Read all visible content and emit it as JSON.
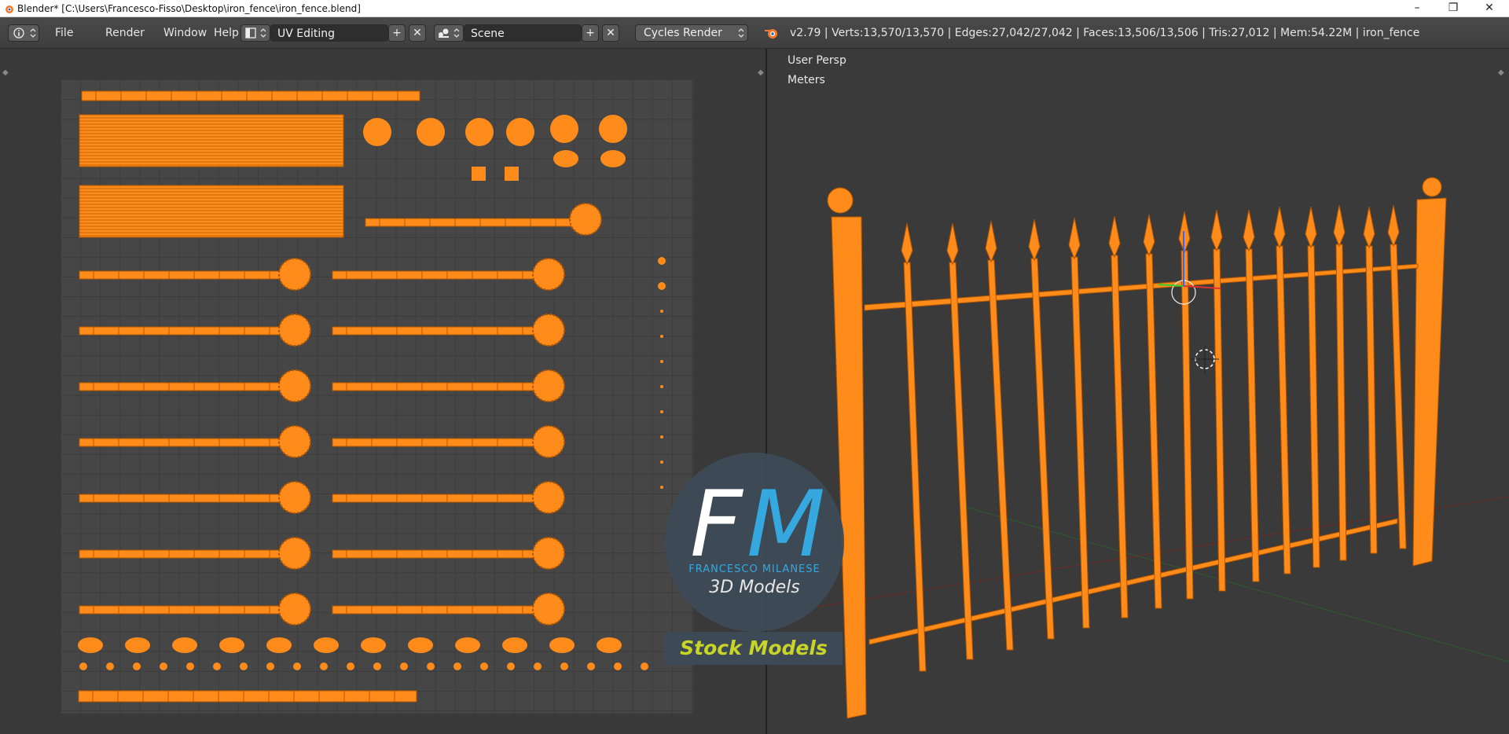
{
  "window": {
    "title": "Blender* [C:\\Users\\Francesco-Fisso\\Desktop\\iron_fence\\iron_fence.blend]",
    "controls": [
      "–",
      "❐",
      "✕"
    ]
  },
  "header": {
    "menus": [
      "File",
      "Render",
      "Window",
      "Help"
    ],
    "screen_layout": "UV Editing",
    "scene": "Scene",
    "render_engine": "Cycles Render",
    "stats": "v2.79 | Verts:13,570/13,570 | Edges:27,042/27,042 | Faces:13,506/13,506 | Tris:27,012 | Mem:54.22M | iron_fence",
    "add_glyph": "+",
    "remove_glyph": "✕"
  },
  "viewport": {
    "view_name": "User Persp",
    "units": "Meters"
  },
  "watermark": {
    "brand": "FRANCESCO MILANESE",
    "product": "3D Models",
    "tag": "Stock Models",
    "letter_f": "F",
    "letter_m": "M"
  },
  "colors": {
    "selection_orange": "#ff8c1a",
    "wire_dark": "#b35600",
    "brand_blue": "#36a8e0",
    "tag_yellow": "#c8d426"
  },
  "icons": [
    "info-icon",
    "layout-icon",
    "scene-icon",
    "render-engine-icon",
    "blender-logo-icon",
    "cursor-3d-icon"
  ]
}
